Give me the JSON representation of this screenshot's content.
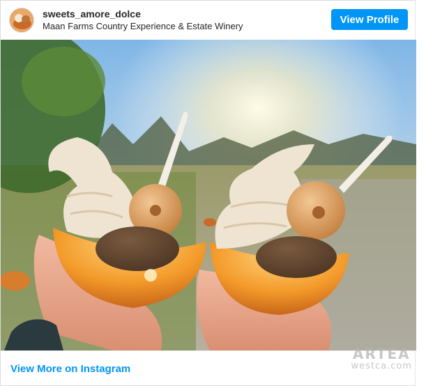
{
  "post": {
    "username": "sweets_amore_dolce",
    "location": "Maan Farms Country Experience & Estate Winery",
    "view_profile_label": "View Profile",
    "view_more_label": "View More on Instagram"
  },
  "photo": {
    "alt": "Two hands holding halved mini pumpkins filled with soft-serve, mini donuts and cookies at sunset",
    "subject_icon": "ice-cream-pumpkin-bowls"
  },
  "watermark": {
    "main": "ARTEA",
    "sub": "westca.com"
  },
  "colors": {
    "accent": "#0095f6",
    "username": "#262626",
    "border": "#dbdbdb"
  }
}
